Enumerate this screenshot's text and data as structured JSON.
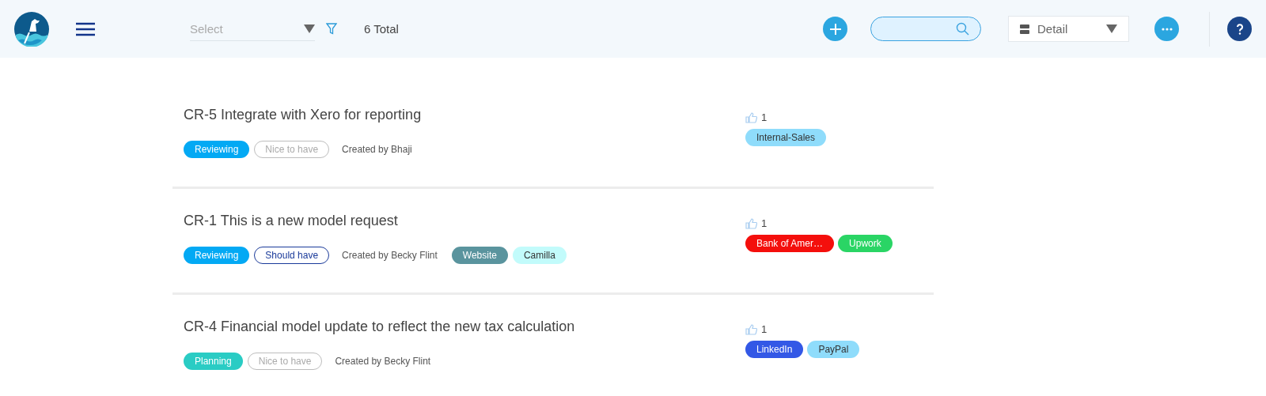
{
  "header": {
    "select": {
      "placeholder": "Select"
    },
    "total": "6 Total",
    "view": "Detail"
  },
  "requests": [
    {
      "title": "CR-5 Integrate with Xero for reporting",
      "status": {
        "label": "Reviewing",
        "color": "#03a9f4"
      },
      "priority": {
        "label": "Nice to have",
        "color": "#bdbdbd"
      },
      "creator": "Created by Bhaji",
      "votes": "1",
      "tags": [
        {
          "label": "Internal-Sales",
          "color": "#8fdcfb"
        }
      ]
    },
    {
      "title": "CR-1 This is a new model request",
      "status": {
        "label": "Reviewing",
        "color": "#03a9f4"
      },
      "priority": {
        "label": "Should have",
        "color": "#1a3a9a"
      },
      "creator": "Created by Becky Flint",
      "labels": [
        {
          "label": "Website",
          "color": "#5a949e"
        },
        {
          "label": "Camilla",
          "color": "#c2fbfb"
        }
      ],
      "votes": "1",
      "tags": [
        {
          "label": "Bank of Amer…",
          "color": "#f40f0c"
        },
        {
          "label": "Upwork",
          "color": "#2ad565"
        }
      ]
    },
    {
      "title": "CR-4 Financial model update to reflect the new tax calculation",
      "status": {
        "label": "Planning",
        "color": "#2accc4"
      },
      "priority": {
        "label": "Nice to have",
        "color": "#bdbdbd"
      },
      "creator": "Created by Becky Flint",
      "votes": "1",
      "tags": [
        {
          "label": "LinkedIn",
          "color": "#3358e6"
        },
        {
          "label": "PayPal",
          "color": "#8fdcfb"
        }
      ]
    }
  ]
}
